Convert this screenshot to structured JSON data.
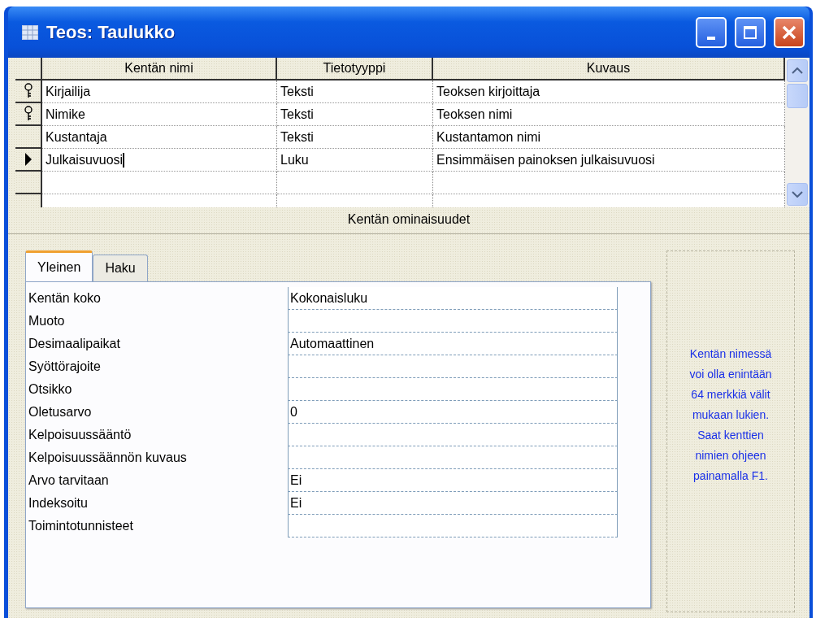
{
  "window": {
    "title": "Teos: Taulukko"
  },
  "table": {
    "columns": [
      "Kentän nimi",
      "Tietotyyppi",
      "Kuvaus"
    ],
    "rows": [
      {
        "primary_key": true,
        "current": false,
        "cells": [
          "Kirjailija",
          "Teksti",
          "Teoksen kirjoittaja"
        ]
      },
      {
        "primary_key": true,
        "current": false,
        "cells": [
          "Nimike",
          "Teksti",
          "Teoksen nimi"
        ]
      },
      {
        "primary_key": false,
        "current": false,
        "cells": [
          "Kustantaja",
          "Teksti",
          "Kustantamon nimi"
        ]
      },
      {
        "primary_key": false,
        "current": true,
        "cells": [
          "Julkaisuvuosi",
          "Luku",
          "Ensimmäisen painoksen julkaisuvuosi"
        ]
      }
    ]
  },
  "properties_title": "Kentän ominaisuudet",
  "tabs": [
    {
      "label": "Yleinen",
      "selected": true
    },
    {
      "label": "Haku",
      "selected": false
    }
  ],
  "properties": [
    {
      "label": "Kentän koko",
      "value": "Kokonaisluku"
    },
    {
      "label": "Muoto"
    },
    {
      "label": "Desimaalipaikat",
      "value": "Automaattinen"
    },
    {
      "label": "Syöttörajoite"
    },
    {
      "label": "Otsikko"
    },
    {
      "label": "Oletusarvo",
      "value": "0"
    },
    {
      "label": "Kelpoisuussääntö"
    },
    {
      "label": "Kelpoisuussäännön kuvaus"
    },
    {
      "label": "Arvo tarvitaan",
      "value": "Ei"
    },
    {
      "label": "Indeksoitu",
      "value": "Ei"
    },
    {
      "label": "Toimintotunnisteet"
    }
  ],
  "help_text": "Kentän nimessä voi olla enintään 64 merkkiä välit mukaan lukien. Saat kenttien nimien ohjeen painamalla F1."
}
